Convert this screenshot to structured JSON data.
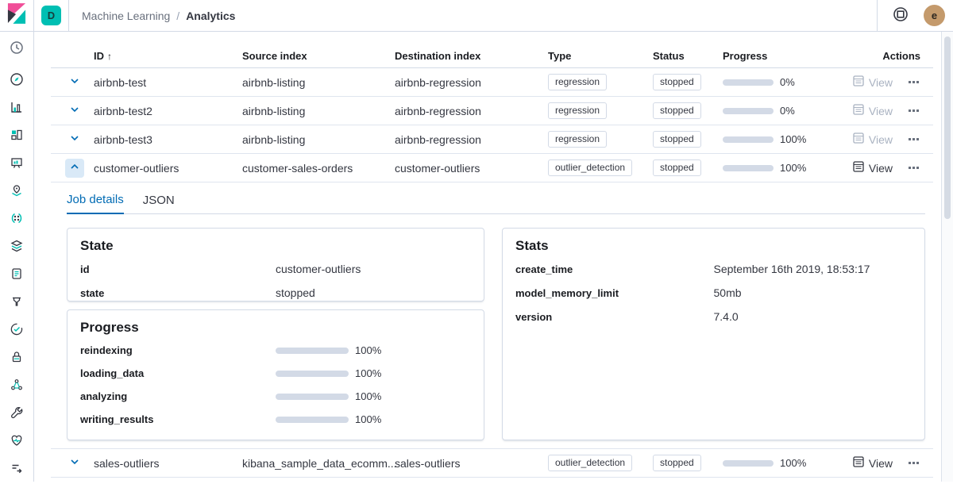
{
  "header": {
    "space_initial": "D",
    "breadcrumb_parent": "Machine Learning",
    "breadcrumb_separator": "/",
    "breadcrumb_current": "Analytics",
    "avatar_initial": "e",
    "icons": [
      "kibana-logo",
      "help-circle-icon",
      "user-avatar"
    ]
  },
  "sidebar": {
    "icons": [
      "recently-viewed-clock",
      "discover-compass",
      "visualize-bar-chart",
      "dashboard",
      "canvas-easel",
      "maps-pin",
      "machine-learning",
      "infrastructure-cube",
      "logs-scroll",
      "apm-funnel",
      "uptime-clock-check",
      "siem-lock",
      "graph-nodes",
      "dev-tools-wrench",
      "monitoring-heartbeat",
      "collapse-menu-arrow"
    ]
  },
  "table": {
    "columns": {
      "id": "ID",
      "source": "Source index",
      "dest": "Destination index",
      "type": "Type",
      "status": "Status",
      "progress": "Progress",
      "actions": "Actions"
    },
    "sort_indicator": "↑",
    "view_label": "View",
    "rows": [
      {
        "id": "airbnb-test",
        "source": "airbnb-listing",
        "dest": "airbnb-regression",
        "type": "regression",
        "status": "stopped",
        "progress": 0,
        "progress_label": "0%",
        "expanded": false,
        "view_enabled": false
      },
      {
        "id": "airbnb-test2",
        "source": "airbnb-listing",
        "dest": "airbnb-regression",
        "type": "regression",
        "status": "stopped",
        "progress": 0,
        "progress_label": "0%",
        "expanded": false,
        "view_enabled": false
      },
      {
        "id": "airbnb-test3",
        "source": "airbnb-listing",
        "dest": "airbnb-regression",
        "type": "regression",
        "status": "stopped",
        "progress": 100,
        "progress_label": "100%",
        "expanded": false,
        "view_enabled": false
      },
      {
        "id": "customer-outliers",
        "source": "customer-sales-orders",
        "dest": "customer-outliers",
        "type": "outlier_detection",
        "status": "stopped",
        "progress": 100,
        "progress_label": "100%",
        "expanded": true,
        "view_enabled": true
      },
      {
        "id": "sales-outliers",
        "source": "kibana_sample_data_ecomm...",
        "dest": "sales-outliers",
        "type": "outlier_detection",
        "status": "stopped",
        "progress": 100,
        "progress_label": "100%",
        "expanded": false,
        "view_enabled": true
      }
    ]
  },
  "details": {
    "tabs": {
      "job_details": "Job details",
      "json": "JSON"
    },
    "active_tab": "Job details",
    "state": {
      "title": "State",
      "rows": [
        {
          "label": "id",
          "value": "customer-outliers"
        },
        {
          "label": "state",
          "value": "stopped"
        }
      ]
    },
    "progress": {
      "title": "Progress",
      "rows": [
        {
          "label": "reindexing",
          "value": 100,
          "text": "100%"
        },
        {
          "label": "loading_data",
          "value": 100,
          "text": "100%"
        },
        {
          "label": "analyzing",
          "value": 100,
          "text": "100%"
        },
        {
          "label": "writing_results",
          "value": 100,
          "text": "100%"
        }
      ]
    },
    "stats": {
      "title": "Stats",
      "rows": [
        {
          "label": "create_time",
          "value": "September 16th 2019, 18:53:17"
        },
        {
          "label": "model_memory_limit",
          "value": "50mb"
        },
        {
          "label": "version",
          "value": "7.4.0"
        }
      ]
    }
  },
  "colors": {
    "primary_blue": "#006BB4",
    "progress_blue": "#006BB4",
    "progress_track": "#D3DAE6",
    "teal": "#00BFB3",
    "logo_pink": "#F04E98",
    "logo_dark": "#343741",
    "border": "#D3DAE6",
    "text_dark": "#343741",
    "text_subdued": "#69707D",
    "avatar_tan": "#C49A6C",
    "expanded_chevron_bg": "#D9E9F7"
  }
}
